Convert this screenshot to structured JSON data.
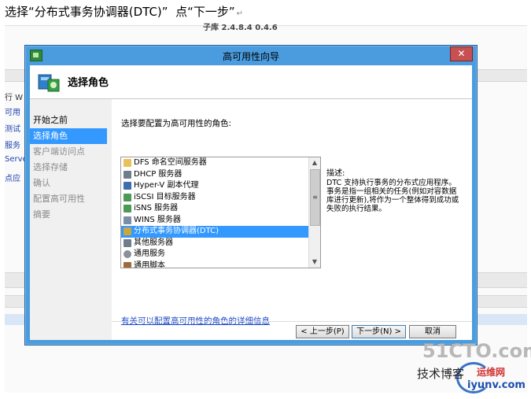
{
  "caption": {
    "text": "选择“分布式事务协调器(DTC)”  点“下一步”",
    "mark": "↵"
  },
  "background": {
    "top_text": "子库 2.4.8.4 0.4.6",
    "left_snippets": [
      "行 W",
      "可用​",
      "测试",
      "服务",
      "Server",
      "点应"
    ]
  },
  "dialog": {
    "title": "高可用性向导",
    "close_label": "✕",
    "header_title": "选择角色",
    "nav": [
      {
        "label": "开始之前",
        "state": "done"
      },
      {
        "label": "选择角色",
        "state": "active"
      },
      {
        "label": "客户端访问点",
        "state": "pending"
      },
      {
        "label": "选择存储",
        "state": "pending"
      },
      {
        "label": "确认",
        "state": "pending"
      },
      {
        "label": "配置高可用性",
        "state": "pending"
      },
      {
        "label": "摘要",
        "state": "pending"
      }
    ],
    "prompt": "选择要配置为高可用性的角色:",
    "roles": [
      {
        "label": "DFS 命名空间服务器",
        "icon": "folder-icon",
        "selected": false
      },
      {
        "label": "DHCP 服务器",
        "icon": "server-icon",
        "selected": false
      },
      {
        "label": "Hyper-V 副本代理",
        "icon": "hyperv-icon",
        "selected": false
      },
      {
        "label": "iSCSI 目标服务器",
        "icon": "iscsi-icon",
        "selected": false
      },
      {
        "label": "iSNS 服务器",
        "icon": "isns-icon",
        "selected": false
      },
      {
        "label": "WINS 服务器",
        "icon": "wins-icon",
        "selected": false
      },
      {
        "label": "分布式事务协调器(DTC)",
        "icon": "dtc-icon",
        "selected": true
      },
      {
        "label": "其他服务器",
        "icon": "server-icon",
        "selected": false
      },
      {
        "label": "通用服务",
        "icon": "gear-icon",
        "selected": false
      },
      {
        "label": "通用脚本",
        "icon": "script-icon",
        "selected": false
      }
    ],
    "description_label": "描述:",
    "description_text": "DTC 支持执行事务的分布式应用程序。事务是指一组相关的任务(例如对容数据库进行更新),将作为一个整体得到成功或失败的执行结果。",
    "more_link": "有关可以配置高可用性的角色的详细信息",
    "buttons": {
      "back": "< 上一步(P)",
      "next": "下一步(N) >",
      "cancel": "取消"
    }
  },
  "watermark": {
    "line1": "51CTO.com",
    "line2": "技术博客",
    "line3": "运维网",
    "line4": "iyunv.com"
  },
  "colors": {
    "frame": "#4a9cdf",
    "selection": "#3399ff",
    "close": "#c75050"
  }
}
